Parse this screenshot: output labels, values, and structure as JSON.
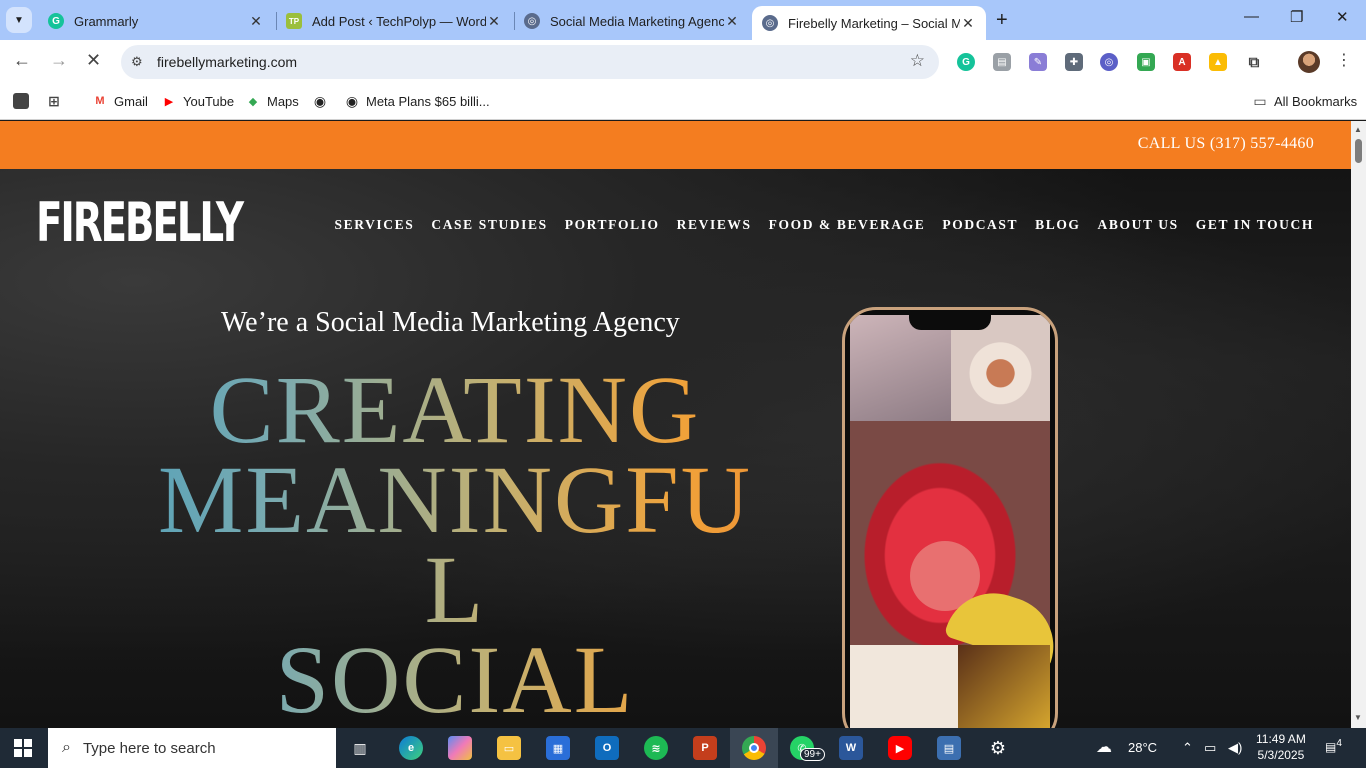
{
  "browser": {
    "tabs": [
      {
        "title": "Grammarly",
        "icon": "G",
        "color": "#15c39a"
      },
      {
        "title": "Add Post ‹ TechPolyp — WordP",
        "icon": "TP",
        "color": "#9bbf3c"
      },
      {
        "title": "Social Media Marketing Agency",
        "icon": "◎",
        "color": "#5a6b8c"
      },
      {
        "title": "Firebelly Marketing – Social Me",
        "icon": "◎",
        "color": "#5a6b8c"
      }
    ],
    "url": "firebellymarketing.com",
    "bookmarks": [
      {
        "label": "Gmail",
        "icon": "M",
        "color": "#ea4335"
      },
      {
        "label": "YouTube",
        "icon": "▶",
        "color": "#ff0000"
      },
      {
        "label": "Maps",
        "icon": "◆",
        "color": "#34a853"
      },
      {
        "label": "",
        "icon": "◉",
        "color": "#222222"
      },
      {
        "label": "Meta Plans $65 billi...",
        "icon": "◉",
        "color": "#222222"
      }
    ],
    "all_bookmarks": "All Bookmarks"
  },
  "site": {
    "call": "CALL US (317) 557-4460",
    "logo": "FIREBELLY",
    "nav": [
      "SERVICES",
      "CASE STUDIES",
      "PORTFOLIO",
      "REVIEWS",
      "FOOD & BEVERAGE",
      "PODCAST",
      "BLOG",
      "ABOUT US",
      "GET IN TOUCH"
    ],
    "tagline": "We’re a Social Media Marketing Agency",
    "headline": [
      "CREATING",
      "MEANINGFU",
      "L",
      "SOCIAL"
    ]
  },
  "taskbar": {
    "search_placeholder": "Type here to search",
    "badge": "99+",
    "weather": "28°C",
    "time": "11:49 AM",
    "date": "5/3/2025",
    "notifications": "4"
  }
}
